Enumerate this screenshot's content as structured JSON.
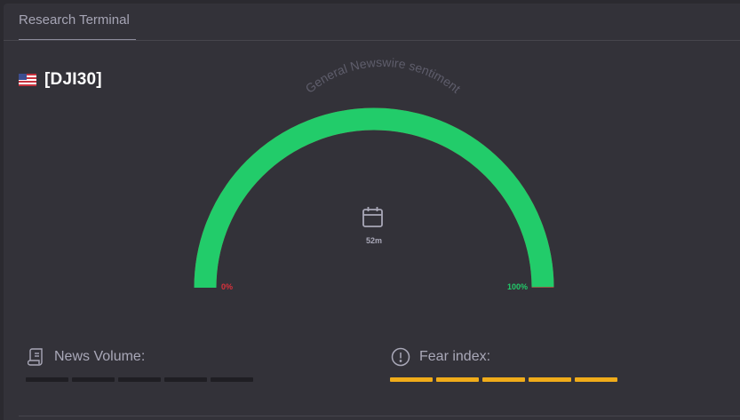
{
  "tabs": [
    {
      "label": "Research Terminal"
    }
  ],
  "instrument": {
    "symbol": "[DJI30]",
    "flag_icon": "us-flag-icon"
  },
  "gauge": {
    "title": "General Newswire sentiment",
    "value_percent": 100,
    "min_label": "0%",
    "max_label": "100%",
    "center_icon": "calendar-icon",
    "timeframe": "52m",
    "colors": {
      "fill": "#22cc6a",
      "min_label": "#d8313b",
      "max_label": "#22cc6a",
      "empty": "#c22c35"
    }
  },
  "news_volume": {
    "label": "News Volume:",
    "icon": "scroll-icon",
    "level": 0,
    "segments": 5,
    "colors": {
      "active": "#f0ac1a",
      "inactive": "#1f1e23"
    }
  },
  "fear_index": {
    "label": "Fear index:",
    "icon": "exclamation-circle-icon",
    "level": 5,
    "segments": 5,
    "colors": {
      "active": "#f0ac1a",
      "inactive": "#1f1e23"
    }
  }
}
